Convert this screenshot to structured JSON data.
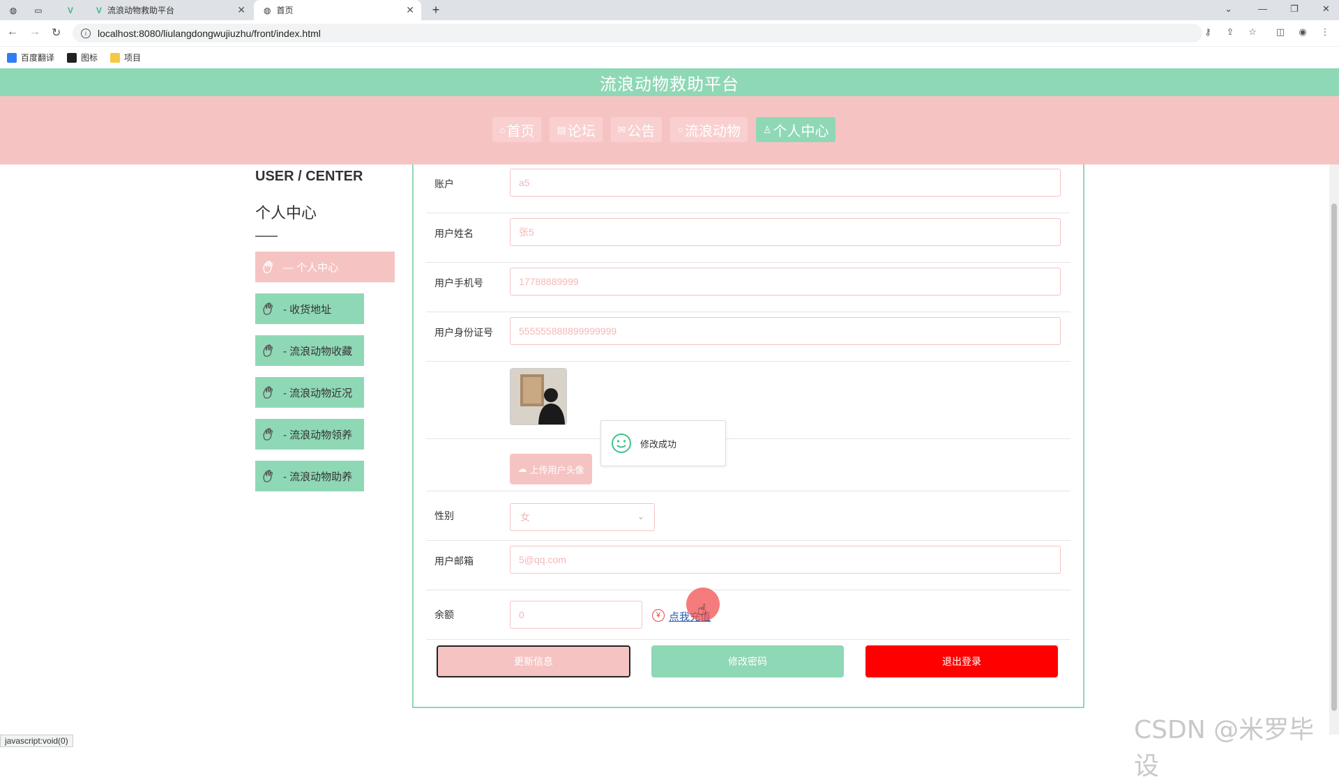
{
  "browser": {
    "tabs": [
      {
        "title": ""
      },
      {
        "title": ""
      },
      {
        "title": ""
      },
      {
        "title": "流浪动物救助平台"
      },
      {
        "title": "首页"
      }
    ],
    "url": "localhost:8080/liulangdongwujiuzhu/front/index.html",
    "bookmarks": [
      "百度翻译",
      "图标",
      "项目"
    ],
    "status_text": "javascript:void(0)"
  },
  "site": {
    "title": "流浪动物救助平台",
    "nav": [
      {
        "icon": "home-icon",
        "label": "首页"
      },
      {
        "icon": "forum-icon",
        "label": "论坛"
      },
      {
        "icon": "mail-icon",
        "label": "公告"
      },
      {
        "icon": "circle-icon",
        "label": "流浪动物"
      },
      {
        "icon": "user-icon",
        "label": "个人中心"
      }
    ]
  },
  "sidebar": {
    "heading_en": "USER / CENTER",
    "heading_cn": "个人中心",
    "items": [
      {
        "label": "— 个人中心"
      },
      {
        "label": "- 收货地址"
      },
      {
        "label": "- 流浪动物收藏"
      },
      {
        "label": "- 流浪动物近况"
      },
      {
        "label": "- 流浪动物领养"
      },
      {
        "label": "- 流浪动物助养"
      }
    ]
  },
  "form": {
    "account": {
      "label": "账户",
      "value": "a5"
    },
    "name": {
      "label": "用户姓名",
      "value": "张5"
    },
    "phone": {
      "label": "用户手机号",
      "value": "17788889999"
    },
    "idcard": {
      "label": "用户身份证号",
      "value": "555555888899999999"
    },
    "upload_label": "上传用户头像",
    "gender": {
      "label": "性别",
      "value": "女"
    },
    "email": {
      "label": "用户邮箱",
      "value": "5@qq.com"
    },
    "balance": {
      "label": "余额",
      "value": "0",
      "recharge_link": "点我充值"
    }
  },
  "toast": {
    "message": "修改成功"
  },
  "actions": {
    "update": "更新信息",
    "password": "修改密码",
    "logout": "退出登录"
  },
  "watermark": "CSDN @米罗毕设",
  "colors": {
    "green": "#8fd8b5",
    "pink": "#f6c3c3",
    "red": "#ff0000"
  }
}
